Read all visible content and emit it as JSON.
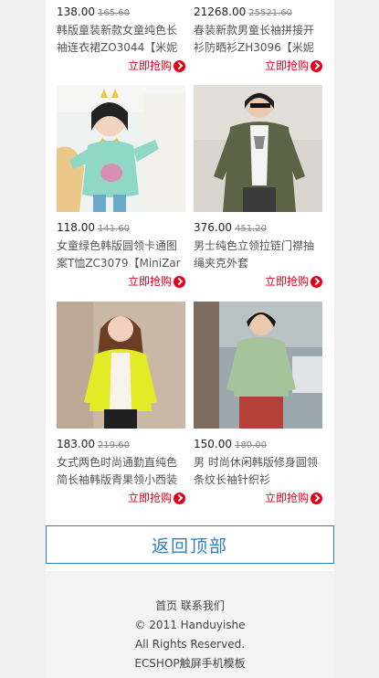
{
  "products": [
    {
      "price": "138.00",
      "old_price": "165.60",
      "title": "韩版童装新款女童纯色长袖连衣裙ZO3044【米妮",
      "buy_label": "立即抢购"
    },
    {
      "price": "21268.00",
      "old_price": "25521.60",
      "title": "春装新款男童长袖拼接开衫防晒衫ZH3096【米妮",
      "buy_label": "立即抢购"
    },
    {
      "price": "118.00",
      "old_price": "141.60",
      "title": "女童绿色韩版圆领卡通图案T恤ZC3079【MiniZaru",
      "buy_label": "立即抢购"
    },
    {
      "price": "376.00",
      "old_price": "451.20",
      "title": "男士纯色立领拉链门襟抽绳夹克外套",
      "buy_label": "立即抢购"
    },
    {
      "price": "183.00",
      "old_price": "219.60",
      "title": "女式两色时尚通勤直纯色简长袖韩版青果领小西装",
      "buy_label": "立即抢购"
    },
    {
      "price": "150.00",
      "old_price": "180.00",
      "title": "男 时尚休闲韩版修身圆领条纹长袖针织衫",
      "buy_label": "立即抢购"
    }
  ],
  "back_to_top": "返回顶部",
  "footer": {
    "home": "首页",
    "contact": "联系我们",
    "copyright": "© 2011 Handuyishe",
    "rights": "All Rights Reserved.",
    "template": "ECSHOP触屏手机模板"
  },
  "colors": {
    "accent_red": "#e4001b",
    "accent_blue": "#2f7fc6"
  }
}
